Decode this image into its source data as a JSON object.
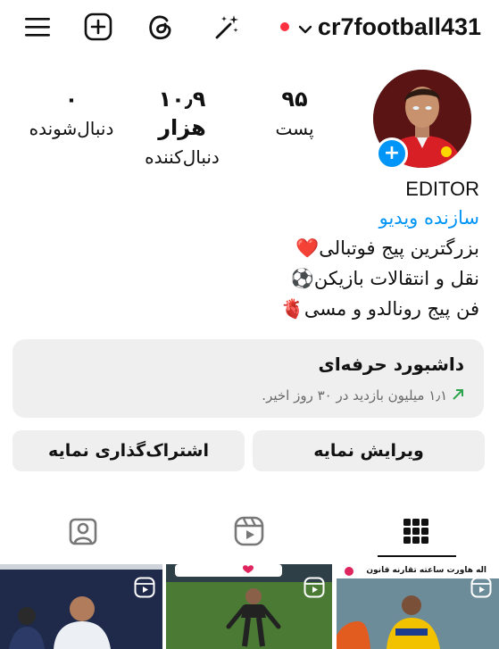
{
  "topbar": {
    "username": "cr7football431",
    "icons": [
      "menu-icon",
      "new-post-icon",
      "threads-icon",
      "magic-wand-icon",
      "chevron-down-icon"
    ],
    "live_dot_color": "#ff3040"
  },
  "profile": {
    "stats": [
      {
        "value": "۹۵",
        "label": "پست"
      },
      {
        "value": "۱۰٫۹ هزار",
        "label": "دنبال‌کننده"
      },
      {
        "value": "۰",
        "label": "دنبال‌شونده"
      }
    ],
    "bio": {
      "name": "EDITOR",
      "category": "سازنده ویدیو",
      "line1": "بزرگترین پیج فوتبالی",
      "line1_emoji": "❤️",
      "line2": "نقل و انتقالات بازیکن",
      "line2_emoji": "⚽",
      "line3": "فن پیج رونالدو و مسی",
      "line3_emoji": "🫀"
    },
    "category_color": "#0095f6"
  },
  "dashboard": {
    "title": "داشبورد حرفه‌ای",
    "subtitle": "۱٫۱ میلیون بازدید در ۳۰ روز اخیر.",
    "arrow_color": "#2ea44f"
  },
  "buttons": {
    "edit": "ویرایش نمایه",
    "share": "اشتراک‌گذاری نمایه"
  },
  "tabs": [
    "grid-icon",
    "reels-icon",
    "tagged-icon"
  ],
  "grid_preview": {
    "right_caption": "اله هاورت ساعته تقارنه قانون"
  }
}
